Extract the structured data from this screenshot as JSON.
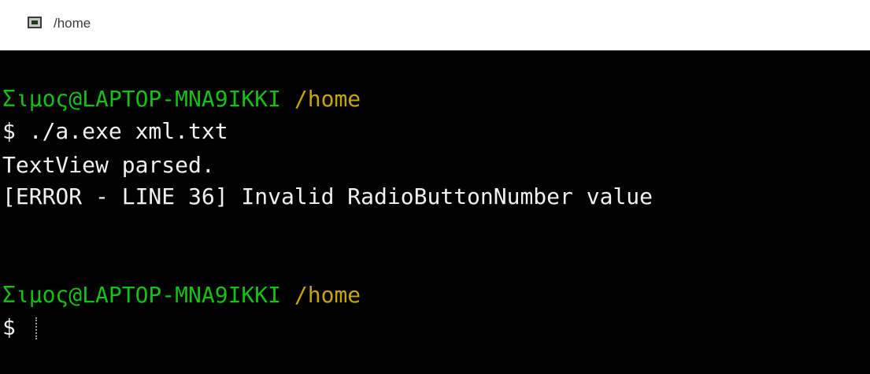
{
  "window": {
    "title": "/home"
  },
  "terminal": {
    "prompt1": {
      "user_host": "Σιμος@LAPTOP-MNA9IKKI",
      "path": "/home"
    },
    "command_line": "$ ./a.exe xml.txt",
    "output": [
      "TextView parsed.",
      "[ERROR - LINE 36] Invalid RadioButtonNumber value"
    ],
    "prompt2": {
      "user_host": "Σιμος@LAPTOP-MNA9IKKI",
      "path": "/home"
    },
    "input_prompt": "$ "
  },
  "colors": {
    "background": "#000000",
    "user_host": "#13c113",
    "path": "#c6a700",
    "text": "#f0f0f0"
  }
}
